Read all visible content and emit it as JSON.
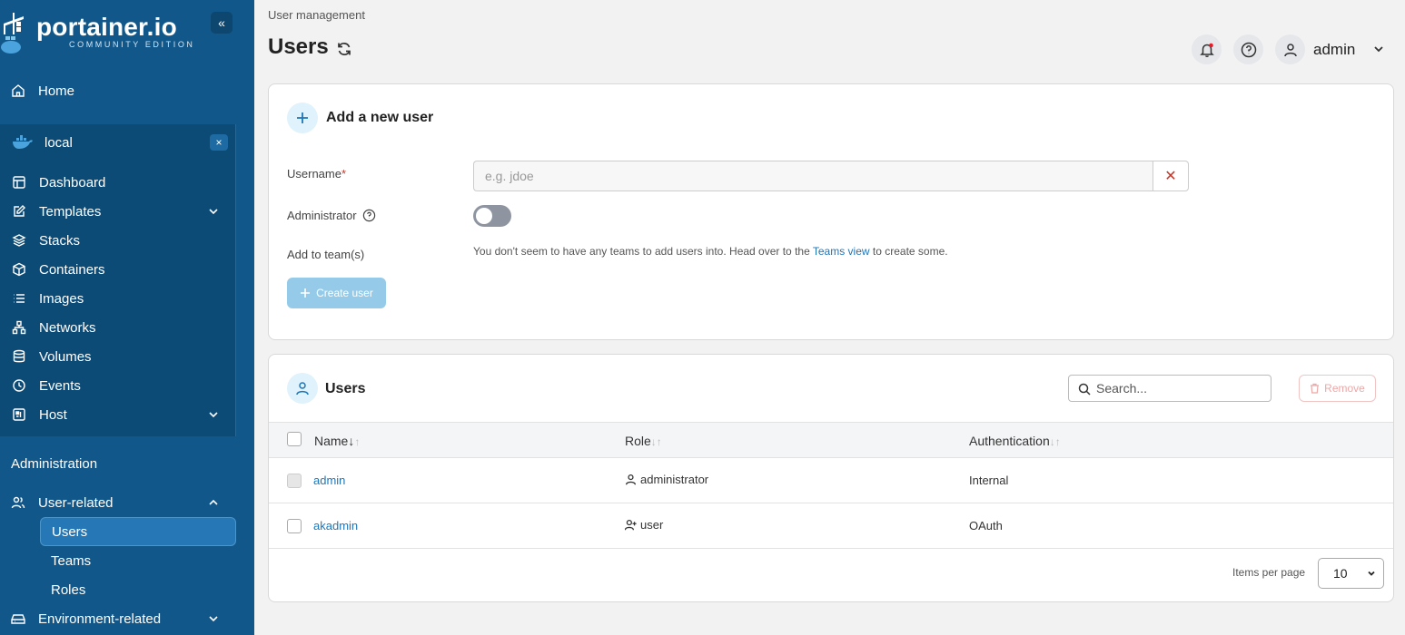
{
  "sidebar": {
    "logo_text": "portainer.io",
    "logo_sub": "COMMUNITY EDITION",
    "collapse_icon": "«",
    "home_label": "Home",
    "environment": {
      "name": "local",
      "close_icon": "×",
      "items": [
        {
          "label": "Dashboard",
          "icon": "dashboard-icon"
        },
        {
          "label": "Templates",
          "icon": "edit-icon",
          "expandable": true
        },
        {
          "label": "Stacks",
          "icon": "layers-icon"
        },
        {
          "label": "Containers",
          "icon": "box-icon"
        },
        {
          "label": "Images",
          "icon": "list-icon"
        },
        {
          "label": "Networks",
          "icon": "network-icon"
        },
        {
          "label": "Volumes",
          "icon": "database-icon"
        },
        {
          "label": "Events",
          "icon": "clock-icon"
        },
        {
          "label": "Host",
          "icon": "server-icon",
          "expandable": true
        }
      ]
    },
    "administration_title": "Administration",
    "user_related": {
      "label": "User-related",
      "children": [
        "Users",
        "Teams",
        "Roles"
      ],
      "active": "Users"
    },
    "environment_related_label": "Environment-related"
  },
  "header": {
    "breadcrumb": "User management",
    "title": "Users",
    "username": "admin"
  },
  "add_user": {
    "title": "Add a new user",
    "username_label": "Username",
    "required_mark": "*",
    "username_placeholder": "e.g. jdoe",
    "clear_icon": "✕",
    "administrator_label": "Administrator",
    "administrator_enabled": false,
    "teams_label": "Add to team(s)",
    "teams_help_prefix": "You don't seem to have any teams to add users into. Head over to the ",
    "teams_help_link": "Teams view",
    "teams_help_suffix": " to create some.",
    "create_button": "Create user"
  },
  "users_table": {
    "title": "Users",
    "search_placeholder": "Search...",
    "remove_button": "Remove",
    "columns": {
      "name": "Name",
      "role": "Role",
      "authentication": "Authentication"
    },
    "sort_active": "↓",
    "sort_inactive": "↓↑",
    "rows": [
      {
        "name": "admin",
        "role": "administrator",
        "authentication": "Internal"
      },
      {
        "name": "akadmin",
        "role": "user",
        "authentication": "OAuth"
      }
    ],
    "items_per_page_label": "Items per page",
    "items_per_page": "10"
  },
  "colors": {
    "sidebar_bg": "#11578a",
    "accent": "#1f76b7",
    "danger": "#c0392b"
  }
}
